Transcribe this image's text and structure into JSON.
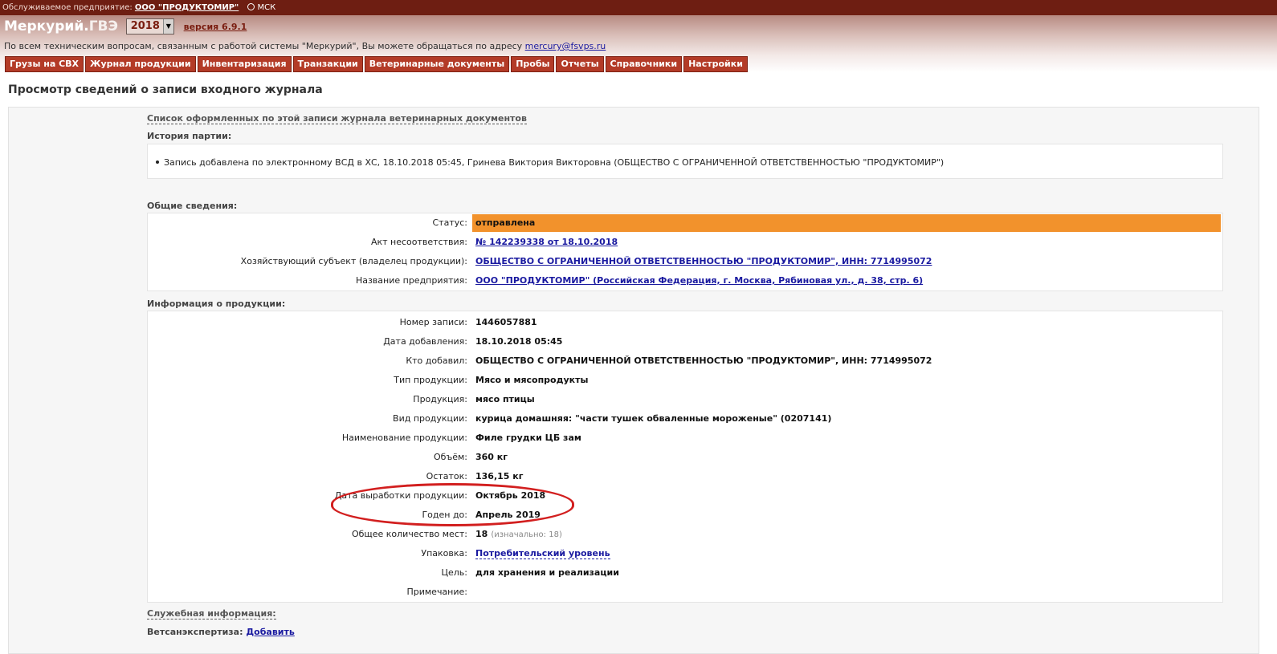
{
  "topbar": {
    "label": "Обслуживаемое предприятие:",
    "org": "ООО \"ПРОДУКТОМИР\"",
    "timezone": "МСК"
  },
  "header": {
    "brand_main": "Меркурий.",
    "brand_sub": "ГВЭ",
    "year": "2018",
    "version": "версия 6.9.1",
    "support_text": "По всем техническим вопросам, связанным с работой системы \"Меркурий\", Вы можете обращаться по адресу",
    "support_email": "mercury@fsvps.ru"
  },
  "menu": [
    "Грузы на СВХ",
    "Журнал продукции",
    "Инвентаризация",
    "Транзакции",
    "Ветеринарные документы",
    "Пробы",
    "Отчеты",
    "Справочники",
    "Настройки"
  ],
  "page": {
    "title": "Просмотр сведений о записи входного журнала",
    "docs_link": "Список оформленных по этой записи журнала ветеринарных документов",
    "history_title": "История партии:",
    "history_item": "Запись добавлена по электронному ВСД в ХС, 18.10.2018 05:45, Гринева Виктория Викторовна (ОБЩЕСТВО С ОГРАНИЧЕННОЙ ОТВЕТСТВЕННОСТЬЮ \"ПРОДУКТОМИР\")"
  },
  "general": {
    "title": "Общие сведения:",
    "status_label": "Статус:",
    "status_value": "отправлена",
    "act_label": "Акт несоответствия:",
    "act_value": "№ 142239338 от 18.10.2018",
    "owner_label": "Хозяйствующий субъект (владелец продукции):",
    "owner_value": "ОБЩЕСТВО С ОГРАНИЧЕННОЙ ОТВЕТСТВЕННОСТЬЮ \"ПРОДУКТОМИР\", ИНН: 7714995072",
    "enterprise_label": "Название предприятия:",
    "enterprise_value": "ООО \"ПРОДУКТОМИР\" (Российская Федерация, г. Москва, Рябиновая ул., д. 38, стр. 6)",
    "status_color": "#f2922c"
  },
  "product": {
    "title": "Информация о продукции:",
    "rows": [
      {
        "label": "Номер записи:",
        "value": "1446057881"
      },
      {
        "label": "Дата добавления:",
        "value": "18.10.2018 05:45"
      },
      {
        "label": "Кто добавил:",
        "value": "ОБЩЕСТВО С ОГРАНИЧЕННОЙ ОТВЕТСТВЕННОСТЬЮ \"ПРОДУКТОМИР\", ИНН: 7714995072"
      },
      {
        "label": "Тип продукции:",
        "value": "Мясо и мясопродукты"
      },
      {
        "label": "Продукция:",
        "value": "мясо птицы"
      },
      {
        "label": "Вид продукции:",
        "value": "курица домашняя: \"части тушек обваленные мороженые\" (0207141)"
      },
      {
        "label": "Наименование продукции:",
        "value": "Филе грудки ЦБ зам"
      },
      {
        "label": "Объём:",
        "value": "360 кг"
      },
      {
        "label": "Остаток:",
        "value": "136,15 кг"
      },
      {
        "label": "Дата выработки продукции:",
        "value": "Октябрь 2018"
      },
      {
        "label": "Годен до:",
        "value": "Апрель 2019"
      },
      {
        "label": "Общее количество мест:",
        "value": "18",
        "extra": "(изначально: 18)"
      },
      {
        "label": "Упаковка:",
        "value": "Потребительский уровень"
      },
      {
        "label": "Цель:",
        "value": "для хранения и реализации"
      },
      {
        "label": "Примечание:",
        "value": ""
      }
    ]
  },
  "service": {
    "title": "Служебная информация:",
    "vet_label": "Ветсанэкспертиза:",
    "vet_action": "Добавить"
  },
  "colors": {
    "topbar": "#6e1e12",
    "menu_bg": "#b33b27",
    "highlight": "#d21f1f"
  }
}
